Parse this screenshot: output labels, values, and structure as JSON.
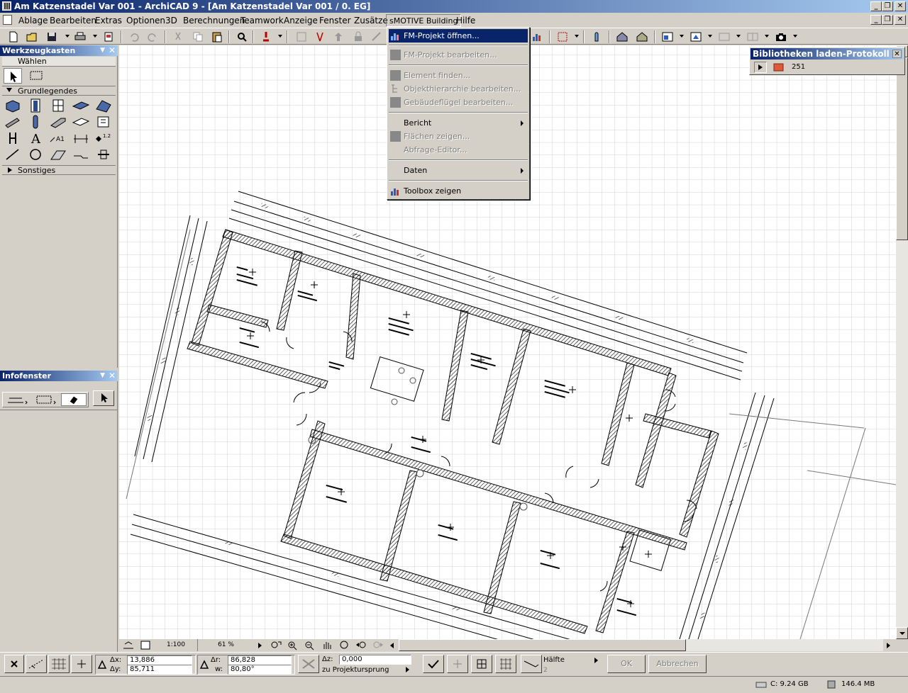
{
  "window": {
    "title": "Am Katzenstadel Var 001 - ArchiCAD 9 - [Am Katzenstadel Var 001 / 0. EG]",
    "min_label": "_",
    "restore_label": "❐",
    "close_label": "✕"
  },
  "menubar": {
    "items": [
      {
        "label": "Ablage"
      },
      {
        "label": "Bearbeiten"
      },
      {
        "label": "Extras"
      },
      {
        "label": "Optionen"
      },
      {
        "label": "3D"
      },
      {
        "label": "Berechnungen"
      },
      {
        "label": "Teamwork"
      },
      {
        "label": "Anzeige"
      },
      {
        "label": "Fenster"
      },
      {
        "label": "Zusätze"
      },
      {
        "label": "sMOTIVE Building"
      },
      {
        "label": "Hilfe"
      }
    ]
  },
  "dropdown": {
    "items": [
      {
        "label": "FM-Projekt öffnen...",
        "state": "highlight"
      },
      {
        "label": "FM-Projekt bearbeiten...",
        "state": "disabled"
      },
      {
        "label": "Element finden...",
        "state": "disabled"
      },
      {
        "label": "Objekthierarchie bearbeiten...",
        "state": "disabled"
      },
      {
        "label": "Gebäudeflügel bearbeiten...",
        "state": "disabled"
      },
      {
        "label": "Bericht",
        "state": "normal",
        "submenu": true
      },
      {
        "label": "Flächen zeigen...",
        "state": "disabled"
      },
      {
        "label": "Abfrage-Editor...",
        "state": "disabled"
      },
      {
        "label": "Daten",
        "state": "normal",
        "submenu": true
      },
      {
        "label": "Toolbox zeigen",
        "state": "normal"
      }
    ]
  },
  "toolbox": {
    "title": "Werkzeugkasten",
    "select_label": "Wählen",
    "section_basic": "Grundlegendes",
    "section_other": "Sonstiges"
  },
  "infobox": {
    "title": "Infofenster"
  },
  "library_panel": {
    "title": "Bibliotheken laden-Protokoll",
    "count": "251"
  },
  "navbar": {
    "scale": "1:100",
    "zoom": "61 %"
  },
  "status": {
    "dx_label": "Δx:",
    "dx_value": "13,886",
    "dy_label": "Δy:",
    "dy_value": "85,711",
    "dr_label": "Δr:",
    "dr_value": "86,828",
    "w_label": "w:",
    "w_value": "80,80°",
    "dz_label": "Δz:",
    "dz_value": "0,000",
    "ref_label": "zu Projektursprung",
    "half_label": "Hälfte",
    "half_value": "2",
    "ok_label": "OK",
    "cancel_label": "Abbrechen"
  },
  "bottom": {
    "disk": "C: 9.24 GB",
    "memory": "146.4 MB"
  },
  "colors": {
    "titlebar_start": "#0a246a",
    "titlebar_end": "#a6caf0",
    "highlight": "#0a246a",
    "chrome": "#d4d0c8"
  }
}
